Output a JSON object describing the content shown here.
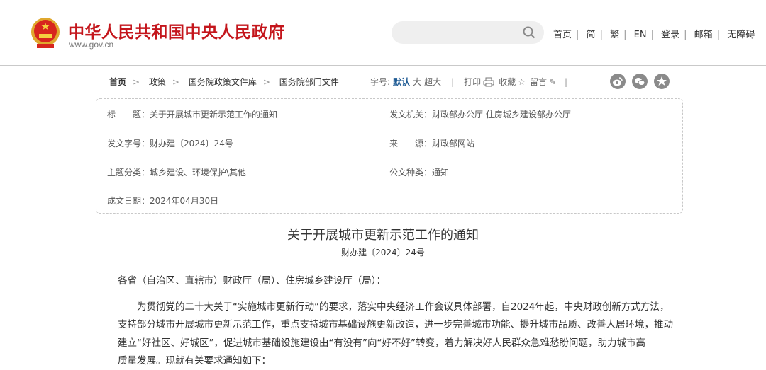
{
  "header": {
    "site_title": "中华人民共和国中央人民政府",
    "site_url": "www.gov.cn",
    "search_placeholder": "",
    "links": [
      "首页",
      "简",
      "繁",
      "EN",
      "登录",
      "邮箱",
      "无障碍"
    ],
    "separator": "|"
  },
  "breadcrumb": {
    "items": [
      "首页",
      "政策",
      "国务院政策文件库",
      "国务院部门文件"
    ],
    "arrow": ">"
  },
  "tools": {
    "font_label": "字号:",
    "font_default": "默认",
    "font_large": "大",
    "font_xlarge": "超大",
    "print": "打印",
    "favorite": "收藏",
    "comment": "留言",
    "separator": "|"
  },
  "info": {
    "title_label": "标　　题：",
    "title": "关于开展城市更新示范工作的通知",
    "issuer_label": "发文机关：",
    "issuer": "财政部办公厅 住房城乡建设部办公厅",
    "docno_label": "发文字号：",
    "docno": "财办建〔2024〕24号",
    "source_label": "来　　源：",
    "source": "财政部网站",
    "topic_label": "主题分类：",
    "topic": "城乡建设、环境保护\\其他",
    "type_label": "公文种类：",
    "type": "通知",
    "date_label": "成文日期：",
    "date": "2024年04月30日"
  },
  "article": {
    "title": "关于开展城市更新示范工作的通知",
    "number": "财办建〔2024〕24号",
    "salutation": "各省（自治区、直辖市）财政厅（局）、住房城乡建设厅（局）：",
    "lines": [
      "为贯彻党的二十大关于“实施城市更新行动”的要求，落实中央经济工作会议具体部署，自2024年起，中央财政创新方式方法，",
      "支持部分城市开展城市更新示范工作，重点支持城市基础设施更新改造，进一步完善城市功能、提升城市品质、改善人居环境，推动",
      "建立“好社区、好城区”，促进城市基础设施建设由“有没有”向“好不好”转变，着力解决好人民群众急难愁盼问题，助力城市高",
      "质量发展。现就有关要求通知如下："
    ]
  },
  "colors": {
    "brand_red": "#c4161c",
    "accent_blue": "#1f5b94"
  }
}
